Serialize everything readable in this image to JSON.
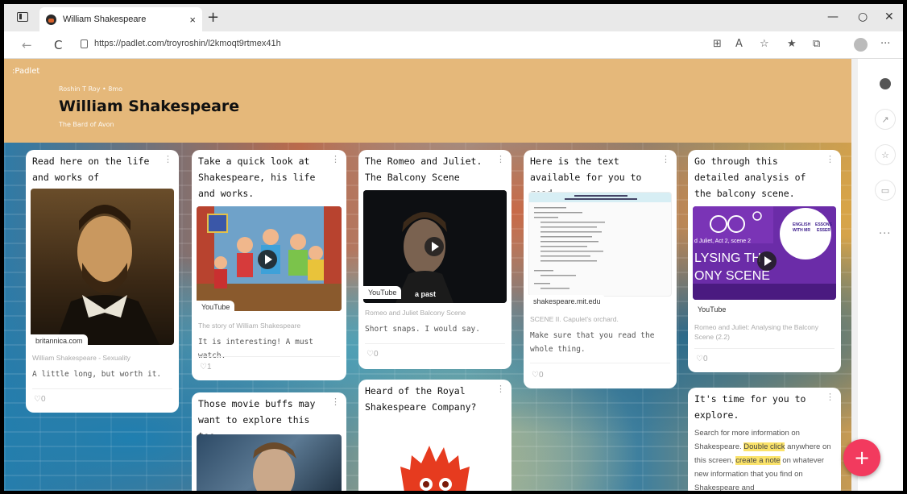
{
  "browser": {
    "tab_title": "William Shakespeare",
    "tab_close": "×",
    "new_tab": "+",
    "url": "https://padlet.com/troyroshin/l2kmoqt9rtmex41h",
    "minimize": "—",
    "restore": "○",
    "close": "✕",
    "back": "←",
    "reload": "C",
    "more": "···"
  },
  "padlet": {
    "logo": ":Padlet",
    "author": "Roshin T Roy • 8mo",
    "title": "William Shakespeare",
    "subtitle": "The Bard of Avon"
  },
  "cards": [
    {
      "title": "Read here on the life and works of Shakespeare",
      "source": "britannica.com",
      "caption": "William Shakespeare - Sexuality",
      "body": "A little long, but worth it.",
      "likes": "0"
    },
    {
      "title": "Take a quick look at Shakespeare, his life and works.",
      "source": "YouTube",
      "caption": "The story of William Shakespeare",
      "body": "It is interesting! A must watch.",
      "likes": "1"
    },
    {
      "title": "The Romeo and Juliet. The Balcony Scene",
      "source": "YouTube",
      "caption": "Romeo and Juliet Balcony Scene",
      "body": "Short snaps. I would say.",
      "likes": "0",
      "overlay": "a past"
    },
    {
      "title": "Here is the text available for you to read.",
      "source": "shakespeare.mit.edu",
      "caption": "SCENE II. Capulet's orchard.",
      "body": "Make sure that you read the whole thing.",
      "likes": "0"
    },
    {
      "title": "Go through this detailed analysis of the balcony scene.",
      "source": "YouTube",
      "caption": "Romeo and Juliet: Analysing the Balcony Scene (2.2)",
      "likes": "0",
      "thumb_line1": "d Juliet, Act 2, scene 2",
      "thumb_line2": "LYSING TH",
      "thumb_line3": "ONY SCENE",
      "thumb_badge1": "ENGLISH",
      "thumb_badge2": "ESSONS",
      "thumb_badge3": "WITH MR",
      "thumb_badge4": "ESSER"
    },
    {
      "title": "Those movie buffs may want to explore this too."
    },
    {
      "title": "Heard of the Royal Shakespeare Company?"
    },
    {
      "title": "It's time for you to explore.",
      "body_a": "Search for more information on Shakespeare.",
      "hl1": "Double click",
      "body_b": "anywhere on this screen,",
      "hl2": "create a note",
      "body_c": "on whatever new information that you find on Shakespeare and"
    }
  ],
  "fab": "+",
  "colors": {
    "header": "#e5b87a",
    "fab": "#f23a5e"
  }
}
